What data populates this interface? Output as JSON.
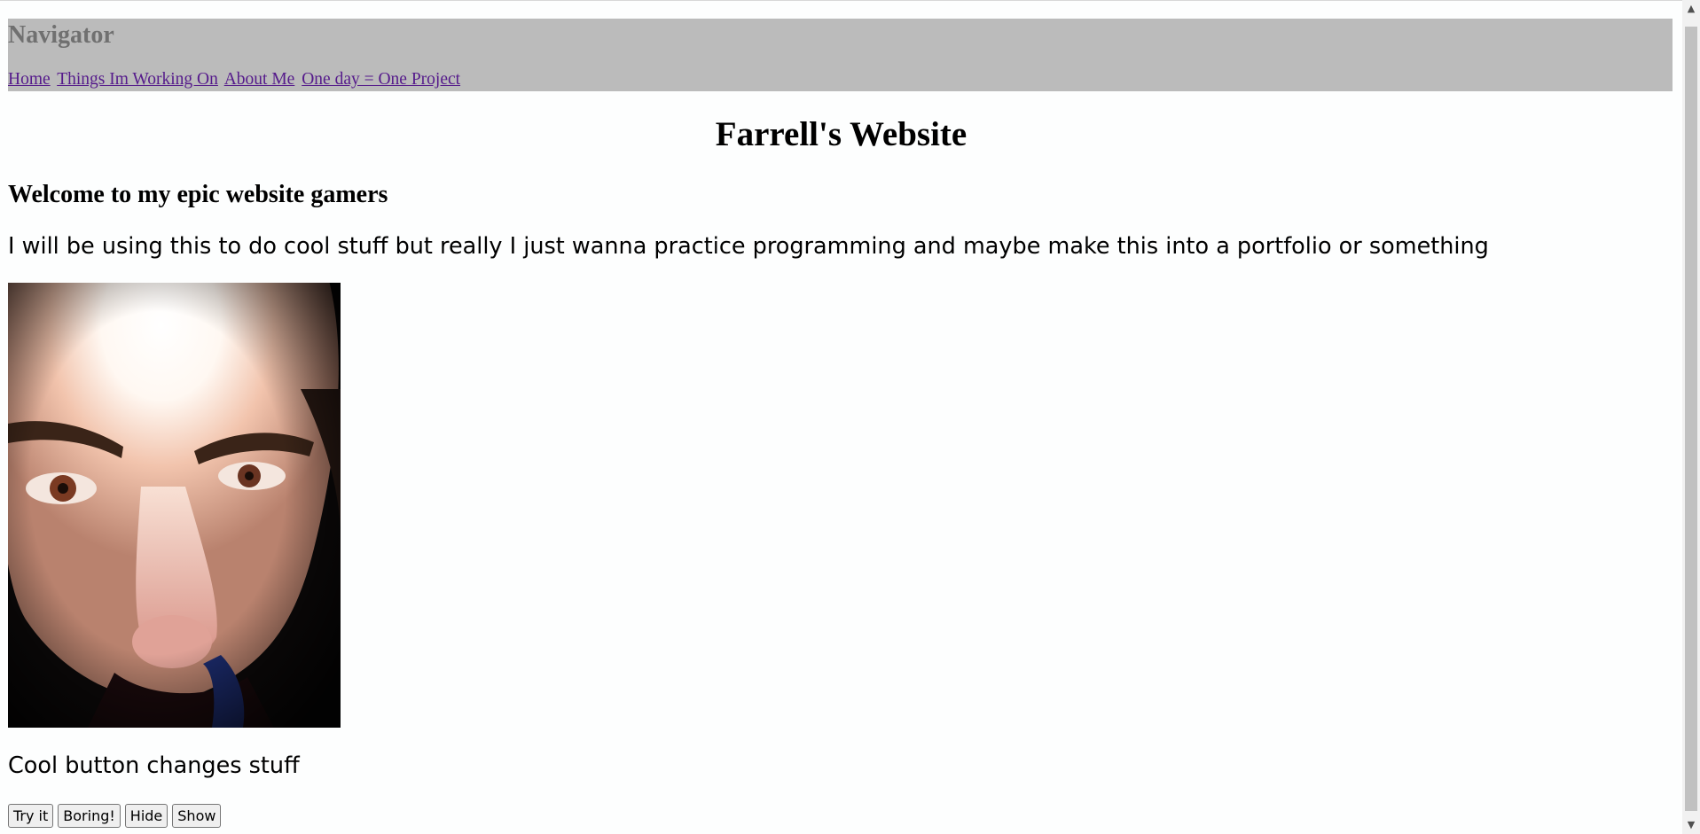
{
  "nav": {
    "title": "Navigator",
    "links": [
      "Home",
      "Things Im Working On",
      "About Me",
      "One day = One Project"
    ]
  },
  "main": {
    "title": "Farrell's Website",
    "welcome": "Welcome to my epic website gamers",
    "intro": "I will be using this to do cool stuff but really I just wanna practice programming and maybe make this into a portfolio or something",
    "cool_text": "Cool button changes stuff",
    "buttons": [
      "Try it",
      "Boring!",
      "Hide",
      "Show"
    ]
  },
  "colors": {
    "nav_bg": "#bbbbbb",
    "nav_title": "#707070",
    "visited_link": "#551a8b"
  },
  "icons": {
    "scroll_up": "▲",
    "scroll_down": "▼"
  }
}
